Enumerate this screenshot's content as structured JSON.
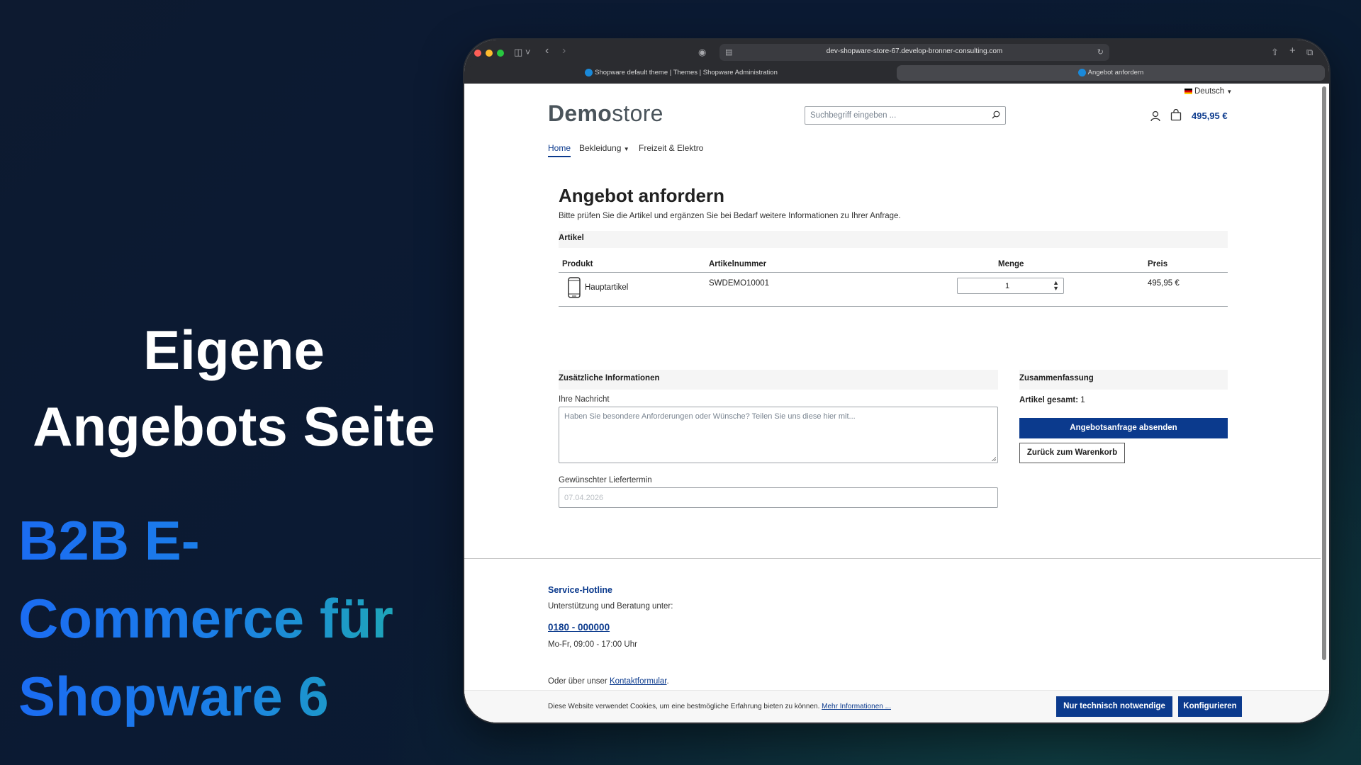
{
  "promo": {
    "heading_line1": "Eigene",
    "heading_line2": "Angebots Seite",
    "sub_line1": "B2B E-",
    "sub_line2": "Commerce für",
    "sub_line3": "Shopware 6"
  },
  "browser": {
    "url": "dev-shopware-store-67.develop-bronner-consulting.com",
    "tabs": [
      {
        "label": "Shopware default theme | Themes | Shopware Administration"
      },
      {
        "label": "Angebot anfordern"
      }
    ]
  },
  "header": {
    "language": "Deutsch",
    "logo_bold": "Demo",
    "logo_rest": "store",
    "search_placeholder": "Suchbegriff eingeben ...",
    "cart_total": "495,95 €"
  },
  "nav": {
    "items": [
      {
        "label": "Home"
      },
      {
        "label": "Bekleidung"
      },
      {
        "label": "Freizeit & Elektro"
      }
    ]
  },
  "main": {
    "title": "Angebot anfordern",
    "intro": "Bitte prüfen Sie die Artikel und ergänzen Sie bei Bedarf weitere Informationen zu Ihrer Anfrage.",
    "articles_section": "Artikel",
    "table": {
      "headers": [
        "Produkt",
        "Artikelnummer",
        "Menge",
        "Preis"
      ],
      "rows": [
        {
          "product": "Hauptartikel",
          "sku": "SWDEMO10001",
          "qty": "1",
          "price": "495,95 €"
        }
      ]
    },
    "additional": {
      "title": "Zusätzliche Informationen",
      "message_label": "Ihre Nachricht",
      "message_placeholder": "Haben Sie besondere Anforderungen oder Wünsche? Teilen Sie uns diese hier mit...",
      "date_label": "Gewünschter Liefertermin",
      "date_value": "07.04.2026"
    },
    "summary": {
      "title": "Zusammenfassung",
      "count_label": "Artikel gesamt:",
      "count_value": "1",
      "submit": "Angebotsanfrage absenden",
      "back": "Zurück zum Warenkorb"
    }
  },
  "footer": {
    "hotline_title": "Service-Hotline",
    "support_text": "Unterstützung und Beratung unter:",
    "phone": "0180 - 000000",
    "hours": "Mo-Fr, 09:00 - 17:00 Uhr",
    "contact_prefix": "Oder über unser ",
    "contact_link": "Kontaktformular",
    "contact_suffix": "."
  },
  "cookie": {
    "text": "Diese Website verwendet Cookies, um eine bestmögliche Erfahrung bieten zu können. ",
    "more_link": "Mehr Informationen ...",
    "btn_necessary": "Nur technisch notwendige",
    "btn_configure": "Konfigurieren"
  },
  "colors": {
    "accent": "#0b3a8d",
    "background": "#0b1a33"
  }
}
